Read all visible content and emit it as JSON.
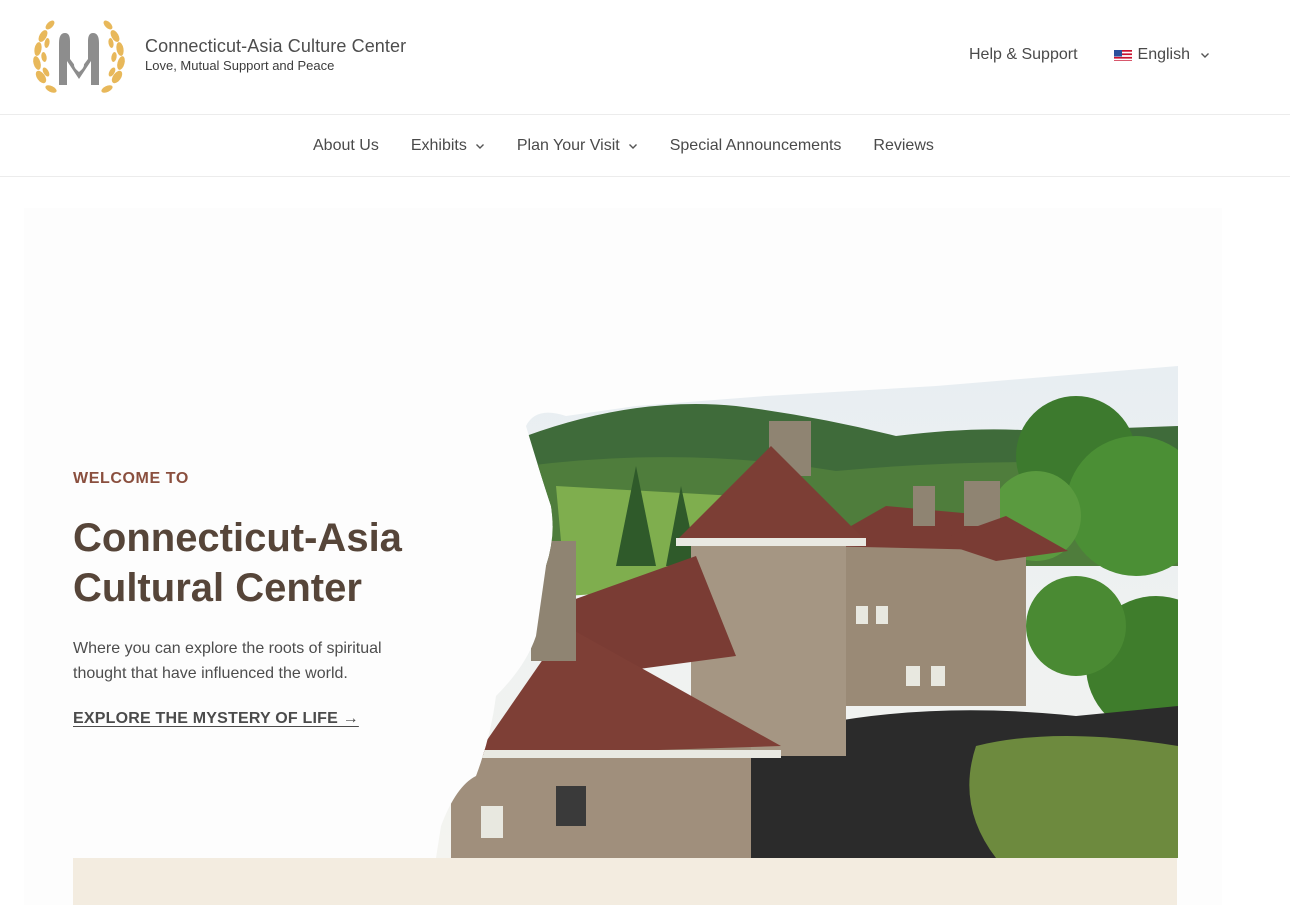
{
  "header": {
    "site_title": "Connecticut-Asia Culture Center",
    "tagline": "Love, Mutual Support and Peace",
    "help_link": "Help & Support",
    "language": "English",
    "logo_icon": "laurel-hands-heart-logo",
    "flag_icon": "us-flag-icon"
  },
  "nav": {
    "items": [
      {
        "label": "About Us",
        "has_dropdown": false
      },
      {
        "label": "Exhibits",
        "has_dropdown": true
      },
      {
        "label": "Plan Your Visit",
        "has_dropdown": true
      },
      {
        "label": "Special Announcements",
        "has_dropdown": false
      },
      {
        "label": "Reviews",
        "has_dropdown": false
      }
    ]
  },
  "hero": {
    "eyebrow": "WELCOME TO",
    "title_line1": "Connecticut-Asia",
    "title_line2": "Cultural Center",
    "description_line1": "Where you can explore the roots of spiritual",
    "description_line2": "thought that have influenced the world.",
    "cta": "EXPLORE THE MYSTERY OF LIFE →"
  },
  "colors": {
    "eyebrow": "#8a4f3e",
    "title": "#564539",
    "band": "#f3ece0",
    "logo_gold": "#e8b85a",
    "logo_gray": "#8d8d8d"
  }
}
